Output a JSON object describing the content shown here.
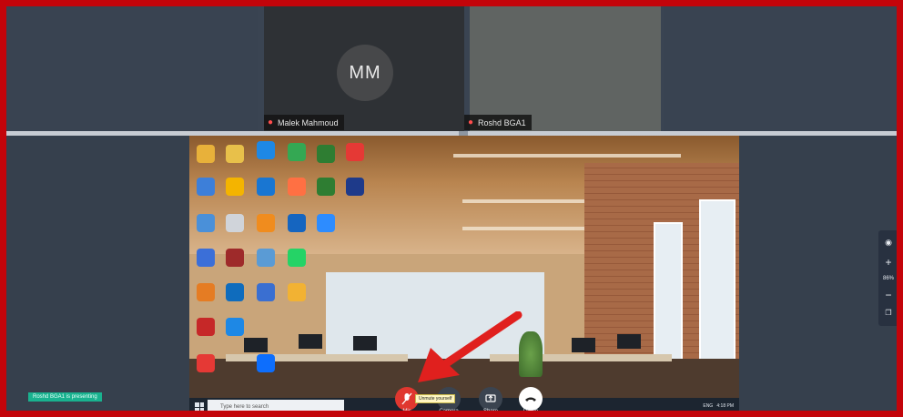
{
  "participants": [
    {
      "initials": "MM",
      "name": "Malek Mahmoud",
      "muted": true
    },
    {
      "initials": "",
      "name": "Roshd BGA1",
      "muted": true
    }
  ],
  "desktop_icons": [
    {
      "label": "",
      "color": "#e8b13a"
    },
    {
      "label": "",
      "color": "#e8c04a"
    },
    {
      "label": "",
      "color": "#1e88e5"
    },
    {
      "label": "",
      "color": "#34a853"
    },
    {
      "label": "",
      "color": "#2e7d32"
    },
    {
      "label": "",
      "color": "#e53935"
    },
    {
      "label": "",
      "color": "#3d7fd9"
    },
    {
      "label": "",
      "color": "#f4b400"
    },
    {
      "label": "",
      "color": "#1976d2"
    },
    {
      "label": "",
      "color": "#ff7043"
    },
    {
      "label": "",
      "color": "#2e7d32"
    },
    {
      "label": "",
      "color": "#1e3a8a"
    },
    {
      "label": "",
      "color": "#4a90d9"
    },
    {
      "label": "",
      "color": "#d0d4da"
    },
    {
      "label": "",
      "color": "#f08c1e"
    },
    {
      "label": "",
      "color": "#1565c0"
    },
    {
      "label": "",
      "color": "#2d8cff"
    },
    {
      "label": "",
      "color": "#3b6fd8"
    },
    {
      "label": "",
      "color": "#9e2a2a"
    },
    {
      "label": "",
      "color": "#5a9bd5"
    },
    {
      "label": "",
      "color": "#25d366"
    },
    {
      "label": "",
      "color": "#e57c23"
    },
    {
      "label": "",
      "color": "#0f6cbd"
    },
    {
      "label": "",
      "color": "#3a6fd1"
    },
    {
      "label": "",
      "color": "#f2b233"
    },
    {
      "label": "",
      "color": "#c62828"
    },
    {
      "label": "",
      "color": "#1e88e5"
    },
    {
      "label": "",
      "color": "#e53935"
    },
    {
      "label": "",
      "color": "#0d6efd"
    }
  ],
  "taskbar": {
    "search_placeholder": "Type here to search",
    "time": "4:18 PM",
    "lang": "ENG"
  },
  "zoom_controls": {
    "mic_label": "Mic",
    "camera_label": "Camera",
    "share_label": "Share",
    "leave_label": "Leave",
    "tooltip": "Unmute yourself"
  },
  "zoom_panel": {
    "zoom_level": "86%"
  },
  "presenting": "Roshd BGA1 is presenting",
  "colors": {
    "frame": "#c3040a",
    "mic_active": "#e0372f",
    "presenting_badge": "#19b28f"
  }
}
